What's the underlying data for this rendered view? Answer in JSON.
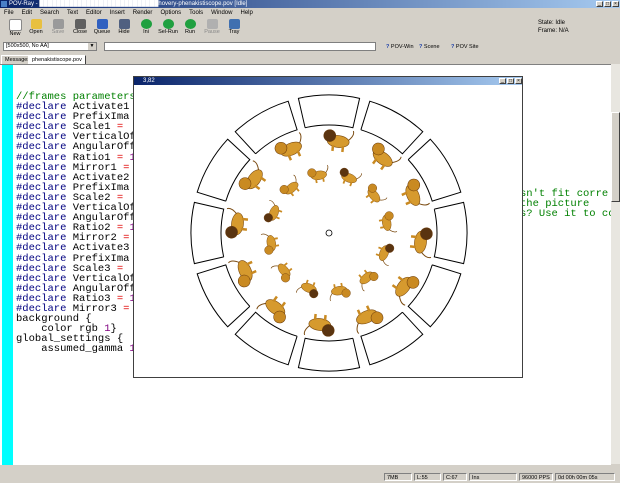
{
  "window": {
    "title": "POV-Ray - ████████████████████████████hovery-phenakistiscope.pov [Idle]"
  },
  "menu": [
    "File",
    "Edit",
    "Search",
    "Text",
    "Editor",
    "Insert",
    "Render",
    "Options",
    "Tools",
    "Window",
    "Help"
  ],
  "toolbar": [
    "New",
    "Open",
    "Save",
    "Close",
    "Queue",
    "Hide",
    "Ini",
    "Sel-Run",
    "Run",
    "Pause",
    "Tray"
  ],
  "status_panel": {
    "state": "State:  Idle",
    "frame": "Frame:  N/A"
  },
  "render_preset": "[500x500, No AA]",
  "links": {
    "povwin": "POV-Win",
    "scene": "Scene",
    "povsite": "POV Site"
  },
  "tabs": [
    "Messages",
    "phenakistiscope.pov"
  ],
  "editor_lines": [
    "//frames parameters",
    "#declare Activate1 ",
    "#declare PrefixIma",
    "#declare Scale1 = ",
    "#declare VerticalOf",
    "#declare AngularOff",
    "#declare Ratio1 = 1",
    "#declare Mirror1 = ",
    "",
    "",
    "#declare Activate2 ",
    "#declare PrefixIma",
    "#declare Scale2 = ",
    "#declare VerticalOf",
    "#declare AngularOff",
    "#declare Ratio2 = 1",
    "#declare Mirror2 = ",
    "",
    "",
    "#declare Activate3 ",
    "#declare PrefixIma",
    "#declare Scale3 = ",
    "#declare VerticalOf",
    "#declare AngularOff",
    "#declare Ratio3 = 1",
    "#declare Mirror3 = ",
    "",
    "",
    "",
    "",
    "background {",
    "    color rgb 1}",
    "",
    "",
    "global_settings {",
    "    assumed_gamma 1.0 }"
  ],
  "editor_right": [
    "sn't fit corre",
    "the picture",
    "s? Use it to co"
  ],
  "render_window": {
    "title": "3,82"
  },
  "statusbar": [
    "7MB",
    "L:55",
    "C:67",
    "Ins",
    "96000 PPS",
    "0d 00h 00m 05s"
  ],
  "colors": {
    "gutter": "#00ffff",
    "titlebar": "#0a246a",
    "comment": "#008000",
    "number": "#800080"
  }
}
